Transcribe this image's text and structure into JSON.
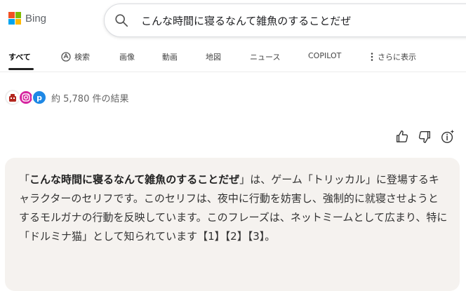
{
  "brand": {
    "name": "Bing",
    "colors": {
      "red": "#f25022",
      "green": "#7fba00",
      "blue": "#00a4ef",
      "yellow": "#ffb900"
    }
  },
  "search": {
    "query": "こんな時間に寝るなんて雑魚のすることだぜ",
    "icon": "search-icon"
  },
  "tabs": {
    "all": "すべて",
    "search": "検索",
    "images": "画像",
    "videos": "動画",
    "maps": "地図",
    "news": "ニュース",
    "copilot": "COPILOT",
    "more": "さらに表示"
  },
  "results": {
    "count_text": "約 5,780 件の結果",
    "favicons": [
      "robot-favicon-icon",
      "instagram-icon",
      "p-app-icon"
    ],
    "favicon_p_letter": "p"
  },
  "feedback": [
    "thumbs-up-icon",
    "thumbs-down-icon",
    "info-sparkle-icon"
  ],
  "answer": {
    "open_quote": "「",
    "highlight": "こんな時間に寝るなんて雑魚のすることだぜ",
    "body": "」は、ゲーム「トリッカル」に登場するキャラクターのセリフです。このセリフは、夜中に行動を妨害し、強制的に就寝させようとするモルガナの行動を反映しています。このフレーズは、ネットミームとして広まり、特に「ドルミナ猫」として知られています【1】【2】【3】。"
  }
}
